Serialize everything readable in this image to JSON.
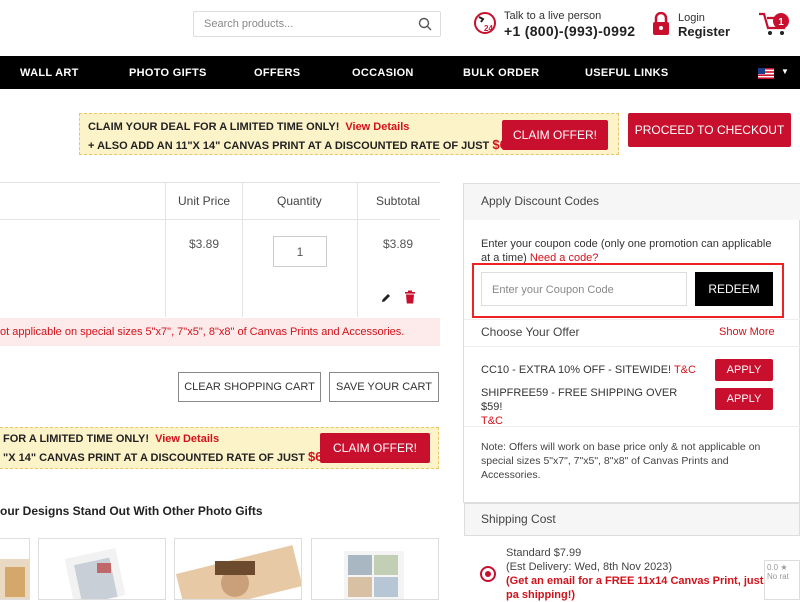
{
  "header": {
    "search_placeholder": "Search products...",
    "phone_label": "Talk to a live person",
    "phone_number": "+1 (800)-(993)-0992",
    "login_label": "Login",
    "register_label": "Register",
    "cart_count": "1"
  },
  "nav": {
    "items": [
      "WALL ART",
      "PHOTO GIFTS",
      "OFFERS",
      "OCCASION",
      "BULK ORDER",
      "USEFUL LINKS"
    ]
  },
  "promo_top": {
    "line1": "CLAIM YOUR DEAL FOR A LIMITED TIME ONLY!",
    "view_details": "View Details",
    "line2": "+ ALSO ADD AN 11\"X 14\" CANVAS PRINT AT A DISCOUNTED RATE OF JUST",
    "price": "$6.99",
    "claim_label": "CLAIM OFFER!"
  },
  "checkout_label": "PROCEED TO CHECKOUT",
  "cart_table": {
    "headers": [
      "Unit Price",
      "Quantity",
      "Subtotal"
    ],
    "row": {
      "unit_price": "$3.89",
      "quantity": "1",
      "subtotal": "$3.89"
    },
    "warning": "ot applicable on special sizes 5\"x7\", 7\"x5\", 8\"x8\" of Canvas Prints and Accessories."
  },
  "cart_actions": {
    "clear": "CLEAR SHOPPING CART",
    "save": "SAVE YOUR CART"
  },
  "promo_bottom": {
    "line1": "FOR A LIMITED TIME ONLY!",
    "view_details": "View Details",
    "line2": "\"X 14\" CANVAS PRINT AT A DISCOUNTED RATE OF JUST",
    "price": "$6.99",
    "claim_label": "CLAIM OFFER!"
  },
  "photo_gifts_title": "our Designs Stand Out With Other Photo Gifts",
  "discount": {
    "title": "Apply Discount Codes",
    "instruction": "Enter your coupon code (only one promotion can applicable at a time)",
    "need_code": "Need a code?",
    "input_placeholder": "Enter your Coupon Code",
    "redeem_label": "REDEEM",
    "choose_title": "Choose Your Offer",
    "show_more": "Show More",
    "offers": [
      {
        "text": "CC10 - EXTRA 10% OFF - SITEWIDE!",
        "tc": "T&C",
        "apply": "APPLY"
      },
      {
        "text": "SHIPFREE59 - FREE SHIPPING OVER $59!",
        "tc": "T&C",
        "apply": "APPLY"
      }
    ],
    "note": "Note: Offers will work on base price only & not applicable on special sizes 5\"x7\", 7\"x5\", 8\"x8\" of Canvas Prints and Accessories."
  },
  "shipping": {
    "title": "Shipping Cost",
    "option_name": "Standard $7.99",
    "delivery": "(Est Delivery: Wed, 8th Nov 2023)",
    "promo": "(Get an email for a FREE 11x14 Canvas Print, just pa shipping!)"
  },
  "review_badge": "0.0 ★ No rat",
  "colors": {
    "brand_red": "#c8102e",
    "nav_bg": "#000000",
    "promo_bg": "#fdf3c9"
  }
}
